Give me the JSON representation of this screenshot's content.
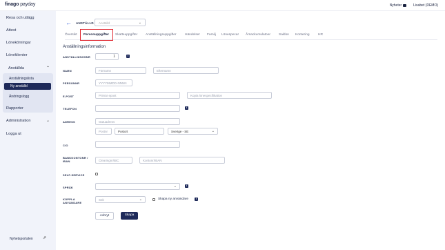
{
  "topbar": {
    "logo_brand": "finago",
    "logo_product": " payday",
    "news_label": "Nyheter",
    "user_label": "Lisabet (DEMO)"
  },
  "sidebar": {
    "items": {
      "travel": "Resa och utlägg",
      "attest": "Attest",
      "salary_runs": "Lönekörningar",
      "salary_clients": "Löneklienter",
      "employees": "Anställda",
      "employee_list": "Anställningslista",
      "new_employee": "Ny anställd",
      "change_log": "Ändringslogg",
      "reports": "Rapporter",
      "administration": "Administration",
      "logout": "Logga ut",
      "news_portal": "Nyhetsportalen"
    }
  },
  "header": {
    "employee_label": "ANSTÄLLD",
    "employee_placeholder": "Anställd"
  },
  "tabs": [
    "Översikt",
    "Personuppgifter",
    "Skatteuppgifter",
    "Anställningsuppgifter",
    "Händelser",
    "Familj",
    "Lönespecar",
    "Årsackumulatoer",
    "Saldon",
    "Kontering",
    "HR"
  ],
  "form": {
    "title": "Anställningsinformation",
    "employment_no_label": "ANSTÄLLNINGSNR",
    "employment_no_value": "1",
    "name_label": "NAMN",
    "first_name_placeholder": "Förnamn",
    "last_name_placeholder": "Efternamn",
    "personal_no_label": "PERSONNR",
    "personal_no_placeholder": "YYYYMMDD-NNNN",
    "email_label": "E-POST",
    "primary_email_placeholder": "Primär epost",
    "copy_email_placeholder": "Kopia lönespecifikation",
    "phone_label": "TELEFON",
    "address_label": "ADRESS",
    "street_placeholder": "Gatuadress",
    "postal_no_placeholder": "Postnr",
    "city_value": "Postort",
    "country_value": "Sverige - SE",
    "co_label": "C/O",
    "bank_label_1": "BANKKONTONR /",
    "bank_label_2": "IBAN",
    "clearing_placeholder": "Clearingnr/BIC",
    "account_placeholder": "Kontonr/IBAN",
    "self_service_label": "SELF-SERVICE",
    "language_label": "SPRÅK",
    "link_user_label_1": "KOPPLA",
    "link_user_label_2": "ANVÄNDARE",
    "search_placeholder": "Sök",
    "create_user_label": "Skapa ny användare",
    "cancel_label": "Avbryt",
    "create_label": "Skapa"
  },
  "colors": {
    "accent_navy": "#1e2a5a",
    "highlight_red": "#e0252e",
    "sidebar_bg": "#f1f3fa"
  }
}
